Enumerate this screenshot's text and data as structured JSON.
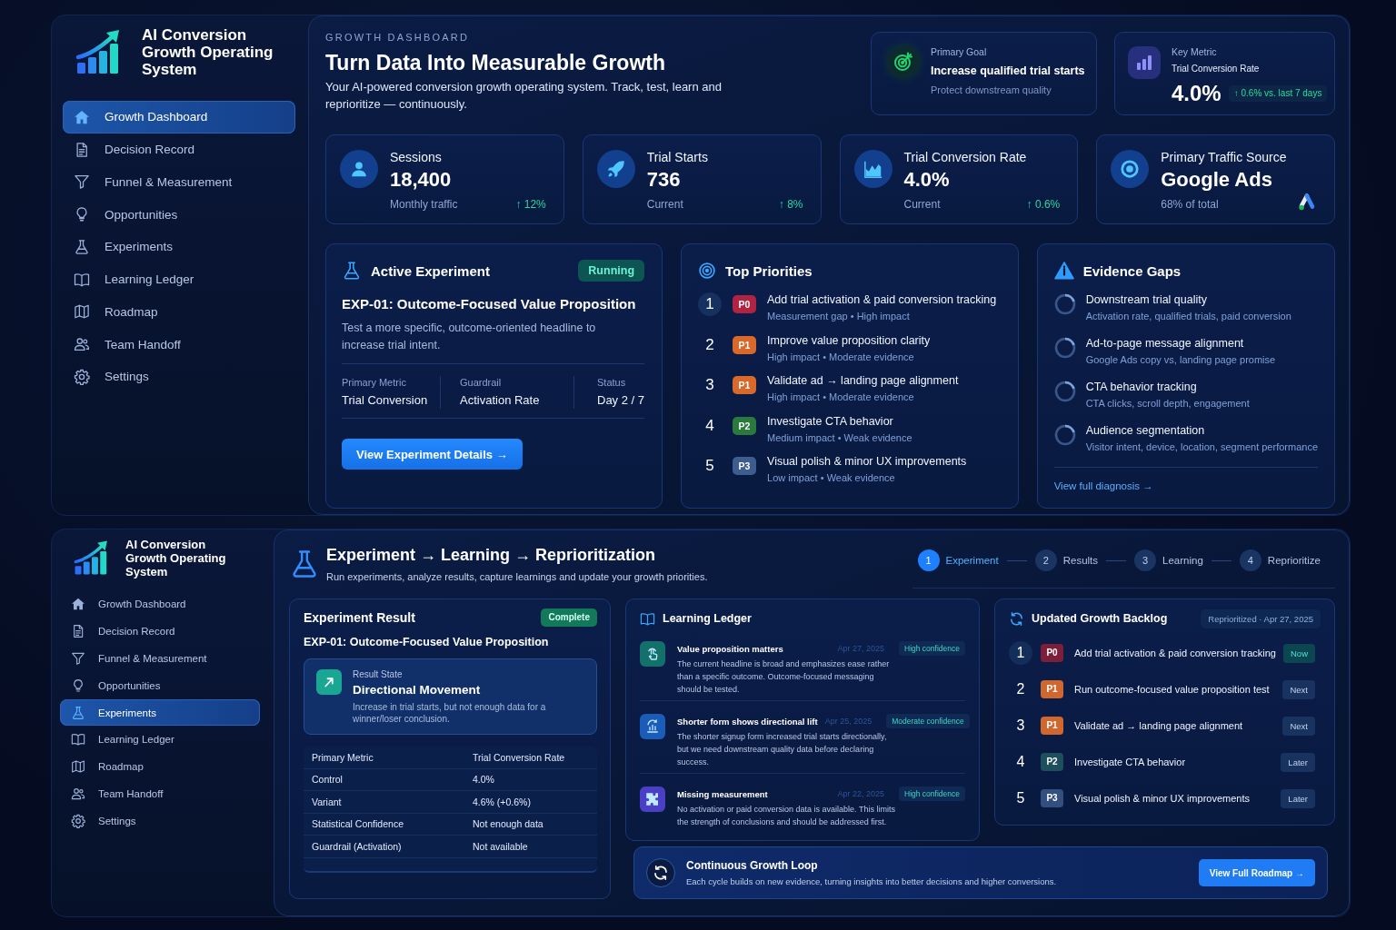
{
  "top_view": {
    "sidebar": {
      "brand": "AI Conversion Growth Operating System",
      "items": [
        {
          "label": "Growth Dashboard",
          "selected": true
        },
        {
          "label": "Decision Record",
          "selected": false
        },
        {
          "label": "Funnel & Measurement",
          "selected": false
        },
        {
          "label": "Opportunities",
          "selected": false
        },
        {
          "label": "Experiments",
          "selected": false
        },
        {
          "label": "Learning Ledger",
          "selected": false
        },
        {
          "label": "Roadmap",
          "selected": false
        },
        {
          "label": "Team Handoff",
          "selected": false
        },
        {
          "label": "Settings",
          "selected": false
        }
      ]
    },
    "header": {
      "eyebrow": "GROWTH DASHBOARD",
      "title": "Turn Data Into Measurable Growth",
      "subtitle": "Your AI-powered conversion growth operating system. Track, test, learn and reprioritize — continuously."
    },
    "primary_goal": {
      "label": "Primary Goal",
      "goal": "Increase qualified trial starts",
      "note": "Protect downstream quality"
    },
    "key_metric": {
      "label": "Key Metric",
      "metric": "Trial Conversion Rate",
      "value": "4.0%",
      "change": "↑ 0.6% vs. last 7 days"
    },
    "stats": [
      {
        "kind": "trend",
        "title": "Sessions",
        "value": "18,400",
        "note": "Monthly traffic",
        "change": "↑ 12%"
      },
      {
        "kind": "trend",
        "title": "Trial Starts",
        "value": "736",
        "note": "Current",
        "change": "↑ 8%"
      },
      {
        "kind": "trend",
        "title": "Trial Conversion Rate",
        "value": "4.0%",
        "note": "Current",
        "change": "↑ 0.6%"
      },
      {
        "kind": "source",
        "title": "Primary Traffic Source",
        "value": "Google Ads",
        "note": "68% of total"
      }
    ],
    "active_experiment": {
      "title": "Active Experiment",
      "status": "Running",
      "name": "EXP-01: Outcome-Focused Value Proposition",
      "description": "Test a more specific, outcome-oriented headline to increase trial intent.",
      "fields": [
        {
          "label": "Primary Metric",
          "value": "Trial Conversion"
        },
        {
          "label": "Guardrail",
          "value": "Activation Rate"
        },
        {
          "label": "Status",
          "value": "Day 2 / 7"
        }
      ],
      "button": "View Experiment Details →"
    },
    "top_priorities": {
      "title": "Top Priorities",
      "items": [
        {
          "rank": "1",
          "priority": "P0",
          "color": "#b02342",
          "title": "Add trial activation & paid conversion tracking",
          "detail": "Measurement gap • High impact",
          "highlighted": true
        },
        {
          "rank": "2",
          "priority": "P1",
          "color": "#d9692a",
          "title": "Improve value proposition clarity",
          "detail": "High impact • Moderate evidence",
          "highlighted": false
        },
        {
          "rank": "3",
          "priority": "P1",
          "color": "#d9692a",
          "title": "Validate ad → landing page alignment",
          "detail": "High impact • Moderate evidence",
          "highlighted": false
        },
        {
          "rank": "4",
          "priority": "P2",
          "color": "#2b7a3d",
          "title": "Investigate CTA behavior",
          "detail": "Medium impact • Weak evidence",
          "highlighted": false
        },
        {
          "rank": "5",
          "priority": "P3",
          "color": "#3d5c8f",
          "title": "Visual polish & minor UX improvements",
          "detail": "Low impact • Weak evidence",
          "highlighted": false
        }
      ]
    },
    "evidence_gaps": {
      "title": "Evidence Gaps",
      "items": [
        {
          "title": "Downstream trial quality",
          "detail": "Activation rate, qualified trials, paid conversion"
        },
        {
          "title": "Ad-to-page message alignment",
          "detail": "Google Ads copy vs, landing page promise"
        },
        {
          "title": "CTA behavior tracking",
          "detail": "CTA clicks, scroll depth, engagement"
        },
        {
          "title": "Audience segmentation",
          "detail": "Visitor intent, device, location, segment performance"
        }
      ],
      "link": "View full diagnosis →"
    }
  },
  "bottom_view": {
    "sidebar": {
      "brand": "AI Conversion Growth Operating System",
      "items": [
        {
          "label": "Growth Dashboard",
          "selected": false
        },
        {
          "label": "Decision Record",
          "selected": false
        },
        {
          "label": "Funnel & Measurement",
          "selected": false
        },
        {
          "label": "Opportunities",
          "selected": false
        },
        {
          "label": "Experiments",
          "selected": true
        },
        {
          "label": "Learning Ledger",
          "selected": false
        },
        {
          "label": "Roadmap",
          "selected": false
        },
        {
          "label": "Team Handoff",
          "selected": false
        },
        {
          "label": "Settings",
          "selected": false
        }
      ]
    },
    "header": {
      "title": "Experiment → Learning → Reprioritization",
      "subtitle": "Run experiments, analyze results, capture learnings and update your growth priorities."
    },
    "steps": [
      {
        "number": "1",
        "label": "Experiment",
        "selected": true
      },
      {
        "number": "2",
        "label": "Results",
        "selected": false
      },
      {
        "number": "3",
        "label": "Learning",
        "selected": false
      },
      {
        "number": "4",
        "label": "Reprioritize",
        "selected": false
      }
    ],
    "experiment_result": {
      "title": "Experiment Result",
      "status": "Complete",
      "name": "EXP-01: Outcome-Focused Value Proposition",
      "result_state": {
        "label": "Result State",
        "value": "Directional Movement",
        "description": "Increase in trial starts, but not enough data for a winner/loser conclusion."
      },
      "rows": [
        {
          "label": "Primary Metric",
          "value": "Trial Conversion Rate"
        },
        {
          "label": "Control",
          "value": "4.0%"
        },
        {
          "label": "Variant",
          "value": "4.6% (+0.6%)"
        },
        {
          "label": "Statistical Confidence",
          "value": "Not enough data"
        },
        {
          "label": "Guardrail (Activation)",
          "value": "Not available"
        }
      ]
    },
    "learning_ledger": {
      "title": "Learning Ledger",
      "entries": [
        {
          "color": "#14706b",
          "title": "Value proposition matters",
          "date": "Apr 27, 2025",
          "confidence": "High confidence",
          "body": "The current headline is broad and emphasizes ease rather than a specific outcome. Outcome-focused messaging should be tested."
        },
        {
          "color": "#1a5cb8",
          "title": "Shorter form shows directional lift",
          "date": "Apr 25, 2025",
          "confidence": "Moderate confidence",
          "body": "The shorter signup form increased trial starts directionally, but we need downstream quality data before declaring success."
        },
        {
          "color": "#4a40c6",
          "title": "Missing measurement",
          "date": "Apr 22, 2025",
          "confidence": "High confidence",
          "body": "No activation or paid conversion data is available. This limits the strength of conclusions and should be addressed first."
        }
      ]
    },
    "backlog": {
      "title": "Updated Growth Backlog",
      "tag": "Reprioritized · Apr 27, 2025",
      "items": [
        {
          "rank": "1",
          "priority": "P0",
          "color": "#7d1f38",
          "title": "Add trial activation & paid conversion tracking",
          "status": "Now",
          "highlighted": true
        },
        {
          "rank": "2",
          "priority": "P1",
          "color": "#d0672f",
          "title": "Run outcome-focused value proposition test",
          "status": "Next",
          "highlighted": false
        },
        {
          "rank": "3",
          "priority": "P1",
          "color": "#d0672f",
          "title": "Validate ad → landing page alignment",
          "status": "Next",
          "highlighted": false
        },
        {
          "rank": "4",
          "priority": "P2",
          "color": "#1d4f5c",
          "title": "Investigate CTA behavior",
          "status": "Later",
          "highlighted": false
        },
        {
          "rank": "5",
          "priority": "P3",
          "color": "#334f80",
          "title": "Visual polish & minor UX improvements",
          "status": "Later",
          "highlighted": false
        }
      ]
    },
    "loop_banner": {
      "title": "Continuous Growth Loop",
      "body": "Each cycle builds on new evidence, turning insights into better decisions and higher conversions.",
      "button": "View Full Roadmap →"
    }
  }
}
